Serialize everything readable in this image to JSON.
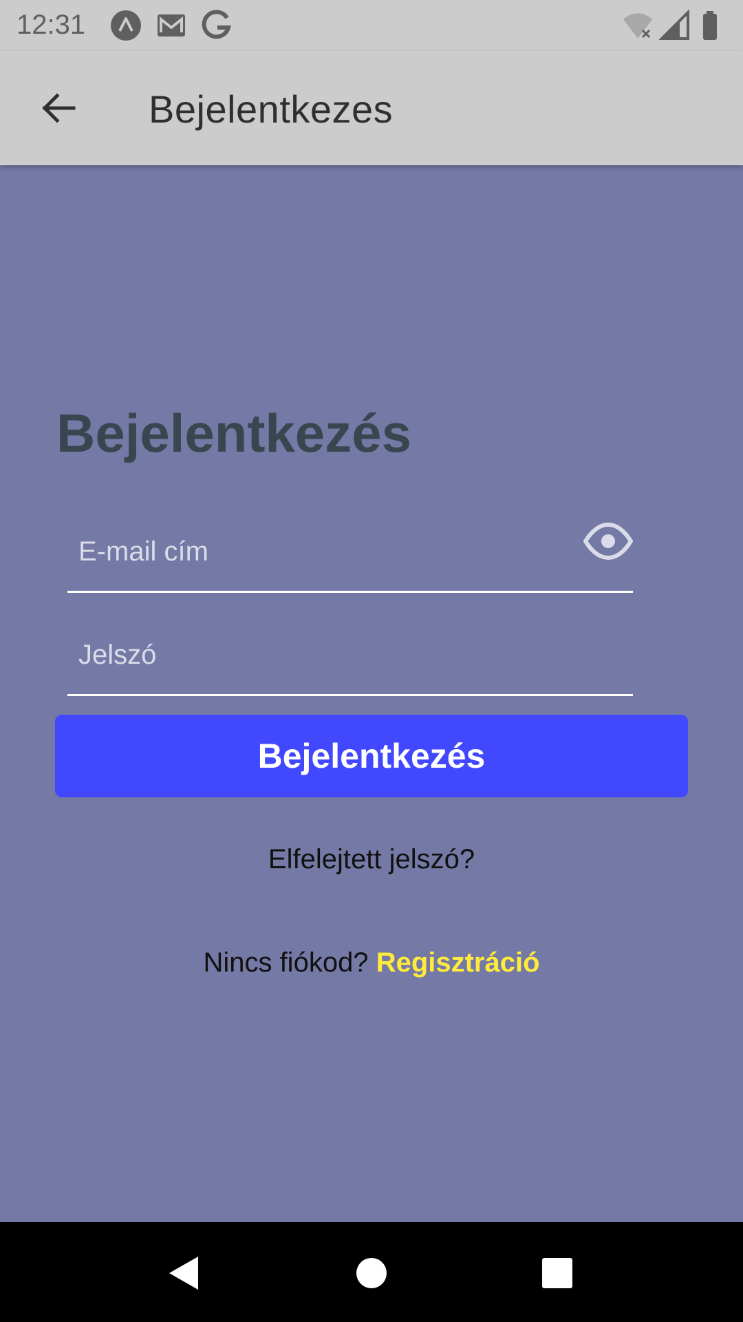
{
  "status_bar": {
    "time": "12:31",
    "left_icons": [
      "app-notification-icon",
      "gmail-icon",
      "google-icon"
    ],
    "right_icons": [
      "wifi-off-icon",
      "signal-icon",
      "battery-icon"
    ]
  },
  "app_bar": {
    "title": "Bejelentkezes",
    "back_icon": "arrow-back-icon"
  },
  "login": {
    "heading": "Bejelentkezés",
    "email_placeholder": "E-mail cím",
    "email_value": "",
    "password_placeholder": "Jelszó",
    "password_value": "",
    "visibility_icon": "eye-icon",
    "submit_label": "Bejelentkezés",
    "forgot_label": "Elfelejtett jelszó?",
    "no_account_label": "Nincs fiókod?",
    "register_label": "Regisztráció"
  },
  "colors": {
    "background": "#7479a5",
    "app_bar": "#cccccc",
    "primary_button": "#4148fe",
    "register_link": "#ffeb3b",
    "heading": "#37464f"
  },
  "nav_bar": {
    "icons": [
      "nav-back-icon",
      "nav-home-icon",
      "nav-recents-icon"
    ]
  }
}
